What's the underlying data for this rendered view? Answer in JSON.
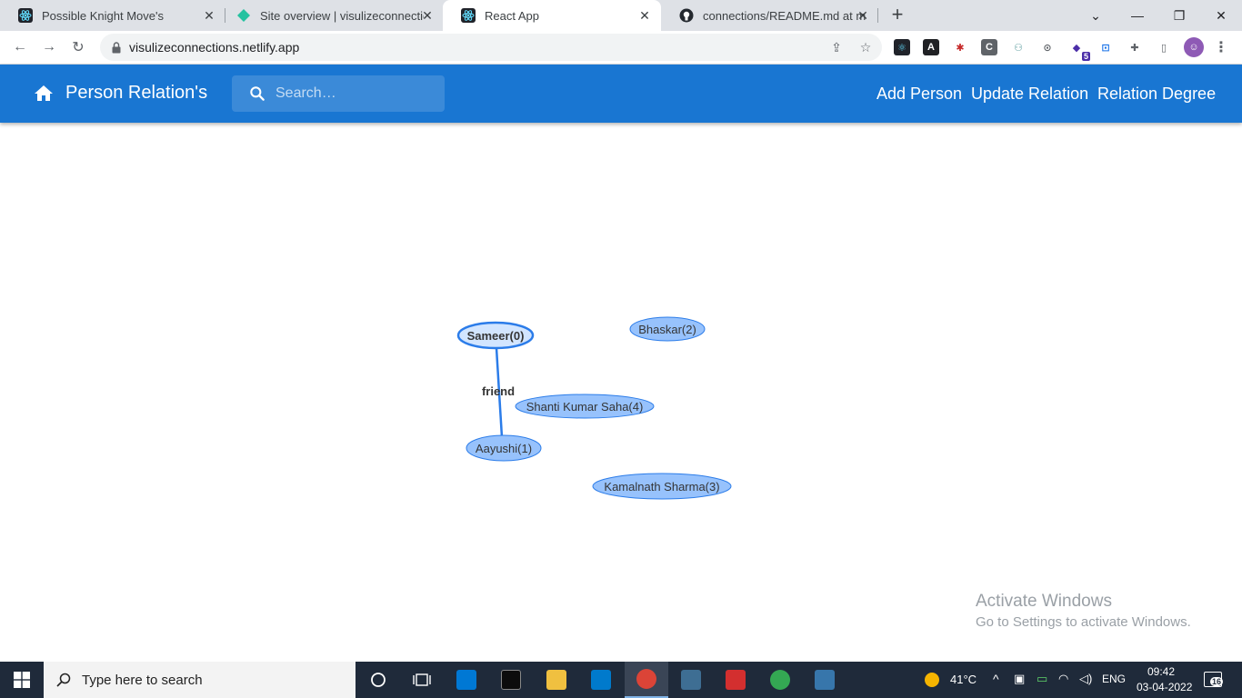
{
  "browser": {
    "tabs": [
      {
        "title": "Possible Knight Move's",
        "favicon": "react-icon",
        "active": false
      },
      {
        "title": "Site overview | visulizeconnectio",
        "favicon": "netlify-icon",
        "active": false
      },
      {
        "title": "React App",
        "favicon": "react-icon",
        "active": true
      },
      {
        "title": "connections/README.md at mas",
        "favicon": "github-icon",
        "active": false
      }
    ],
    "url": "visulizeconnections.netlify.app",
    "extension_badge": "5"
  },
  "app": {
    "brand": "Person Relation's",
    "search_placeholder": "Search…",
    "nav": {
      "add_person": "Add Person",
      "update_relation": "Update Relation",
      "relation_degree": "Relation Degree"
    },
    "accent_color": "#1976d2"
  },
  "graph": {
    "nodes": [
      {
        "id": 0,
        "label": "Sameer(0)",
        "selected": true
      },
      {
        "id": 2,
        "label": "Bhaskar(2)",
        "selected": false
      },
      {
        "id": 4,
        "label": "Shanti Kumar Saha(4)",
        "selected": false
      },
      {
        "id": 1,
        "label": "Aayushi(1)",
        "selected": false
      },
      {
        "id": 3,
        "label": "Kamalnath Sharma(3)",
        "selected": false
      }
    ],
    "edges": [
      {
        "from": 0,
        "to": 1,
        "label": "friend"
      }
    ],
    "node_color": "#97c2fc",
    "node_border": "#2b7ce9"
  },
  "watermark": {
    "line1": "Activate Windows",
    "line2": "Go to Settings to activate Windows."
  },
  "taskbar": {
    "search_text": "Type here to search",
    "temperature": "41°C",
    "language": "ENG",
    "time": "09:42",
    "date": "03-04-2022",
    "notifications": "16"
  }
}
